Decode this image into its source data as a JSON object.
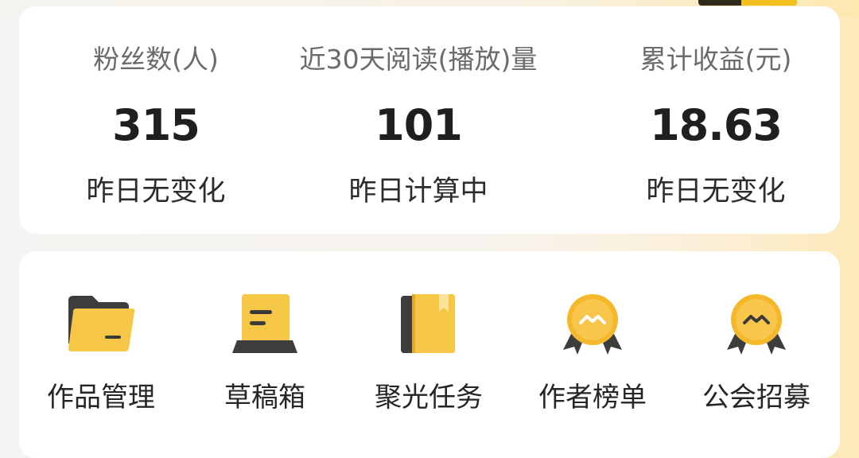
{
  "stats": [
    {
      "label": "粉丝数(人)",
      "value": "315",
      "change": "昨日无变化"
    },
    {
      "label": "近30天阅读(播放)量",
      "value": "101",
      "change": "昨日计算中"
    },
    {
      "label": "累计收益(元)",
      "value": "18.63",
      "change": "昨日无变化"
    }
  ],
  "tools": [
    {
      "label": "作品管理",
      "icon": "folder-icon"
    },
    {
      "label": "草稿箱",
      "icon": "draft-box-icon"
    },
    {
      "label": "聚光任务",
      "icon": "bookmark-book-icon"
    },
    {
      "label": "作者榜单",
      "icon": "medal-icon"
    },
    {
      "label": "公会招募",
      "icon": "medal-icon"
    }
  ],
  "colors": {
    "accent_yellow": "#f6c333",
    "dark_icon": "#3a3a3a",
    "value_text": "#1f1f1f",
    "label_text": "#6b6b6b"
  }
}
